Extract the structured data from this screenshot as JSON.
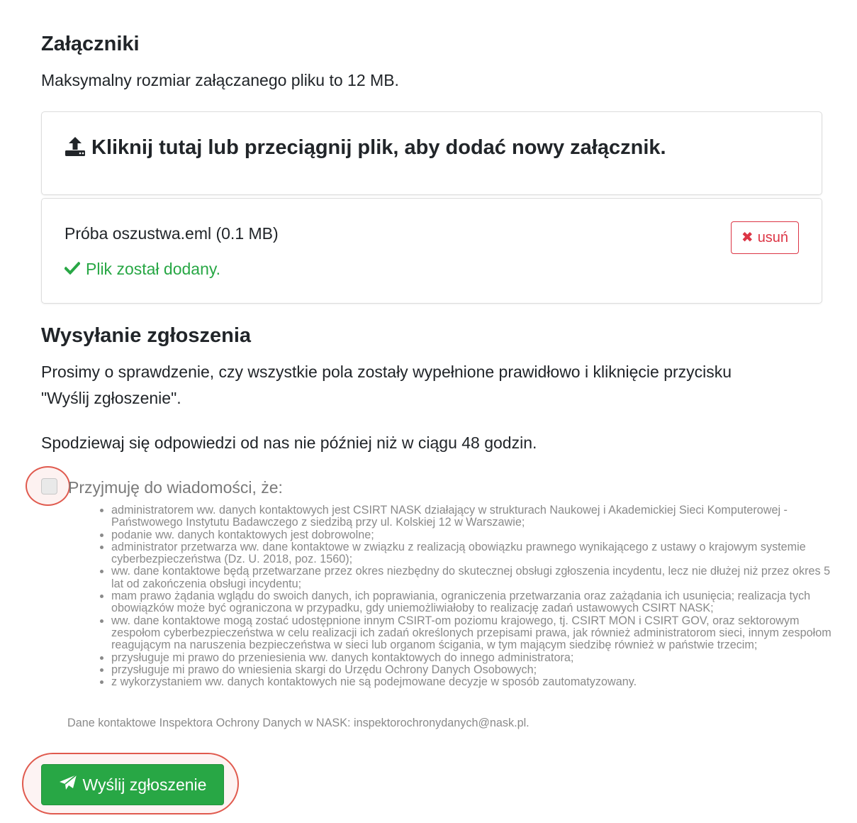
{
  "attachments": {
    "heading": "Załączniki",
    "max_size_note": "Maksymalny rozmiar załączanego pliku to 12 MB.",
    "dropzone_label": "Kliknij tutaj lub przeciągnij plik, aby dodać nowy załącznik.",
    "upload_icon": "upload-icon",
    "file": {
      "name": "Próba oszustwa.eml (0.1 MB)",
      "status": "Plik został dodany.",
      "status_icon": "check-icon",
      "status_color": "#28a745",
      "remove_label": "usuń",
      "remove_icon": "close-icon",
      "remove_color": "#dc3545"
    }
  },
  "submission": {
    "heading": "Wysyłanie zgłoszenia",
    "instruction_line1": "Prosimy o sprawdzenie, czy wszystkie pola zostały wypełnione prawidłowo i kliknięcie przycisku",
    "instruction_line2": "\"Wyślij zgłoszenie\".",
    "response_note": "Spodziewaj się odpowiedzi od nas nie później niż w ciągu 48 godzin.",
    "consent_label": "Przyjmuję do wiadomości, że:",
    "consent_checked": false,
    "terms": [
      "administratorem ww. danych kontaktowych jest CSIRT NASK działający w strukturach Naukowej i Akademickiej Sieci Komputerowej - Państwowego Instytutu Badawczego z siedzibą przy ul. Kolskiej 12 w Warszawie;",
      "podanie ww. danych kontaktowych jest dobrowolne;",
      "administrator przetwarza ww. dane kontaktowe w związku z realizacją obowiązku prawnego wynikającego z ustawy o krajowym systemie cyberbezpieczeństwa (Dz. U. 2018, poz. 1560);",
      "ww. dane kontaktowe będą przetwarzane przez okres niezbędny do skutecznej obsługi zgłoszenia incydentu, lecz nie dłużej niż przez okres 5 lat od zakończenia obsługi incydentu;",
      "mam prawo żądania wglądu do swoich danych, ich poprawiania, ograniczenia przetwarzania oraz zażądania ich usunięcia; realizacja tych obowiązków może być ograniczona w przypadku, gdy uniemożliwiałoby to realizację zadań ustawowych CSIRT NASK;",
      "ww. dane kontaktowe mogą zostać udostępnione innym CSIRT-om poziomu krajowego, tj. CSIRT MON i CSIRT GOV, oraz sektorowym zespołom cyberbezpieczeństwa w celu realizacji ich zadań określonych przepisami prawa, jak również administratorom sieci, innym zespołom reagującym na naruszenia bezpieczeństwa w sieci lub organom ścigania, w tym mającym siedzibę również w państwie trzecim;",
      "przysługuje mi prawo do przeniesienia ww. danych kontaktowych do innego administratora;",
      "przysługuje mi prawo do wniesienia skargi do Urzędu Ochrony Danych Osobowych;",
      "z wykorzystaniem ww. danych kontaktowych nie są podejmowane decyzje w sposób zautomatyzowany."
    ],
    "iod_contact": "Dane kontaktowe Inspektora Ochrony Danych w NASK: inspektorochronydanych@nask.pl.",
    "submit_label": "Wyślij zgłoszenie",
    "submit_icon": "paper-plane-icon",
    "submit_color": "#28a745"
  }
}
